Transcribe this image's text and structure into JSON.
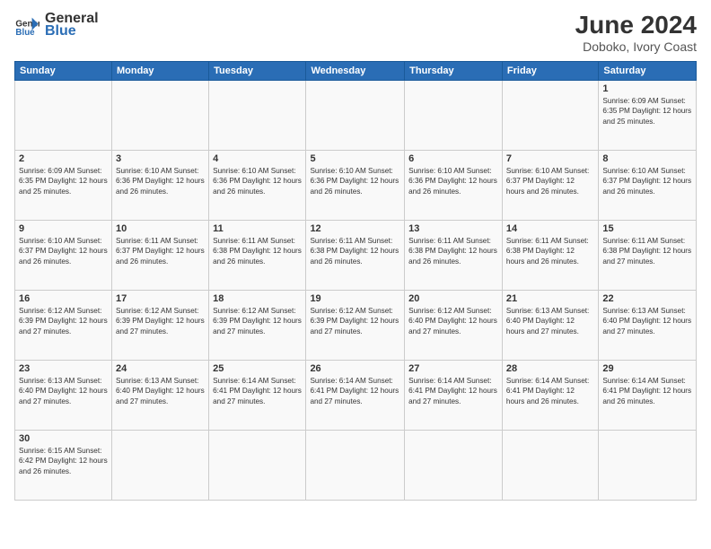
{
  "header": {
    "logo_general": "General",
    "logo_blue": "Blue",
    "month_title": "June 2024",
    "subtitle": "Doboko, Ivory Coast"
  },
  "days_of_week": [
    "Sunday",
    "Monday",
    "Tuesday",
    "Wednesday",
    "Thursday",
    "Friday",
    "Saturday"
  ],
  "weeks": [
    [
      {
        "day": "",
        "info": ""
      },
      {
        "day": "",
        "info": ""
      },
      {
        "day": "",
        "info": ""
      },
      {
        "day": "",
        "info": ""
      },
      {
        "day": "",
        "info": ""
      },
      {
        "day": "",
        "info": ""
      },
      {
        "day": "1",
        "info": "Sunrise: 6:09 AM\nSunset: 6:35 PM\nDaylight: 12 hours and 25 minutes."
      }
    ],
    [
      {
        "day": "2",
        "info": "Sunrise: 6:09 AM\nSunset: 6:35 PM\nDaylight: 12 hours and 25 minutes."
      },
      {
        "day": "3",
        "info": "Sunrise: 6:10 AM\nSunset: 6:36 PM\nDaylight: 12 hours and 26 minutes."
      },
      {
        "day": "4",
        "info": "Sunrise: 6:10 AM\nSunset: 6:36 PM\nDaylight: 12 hours and 26 minutes."
      },
      {
        "day": "5",
        "info": "Sunrise: 6:10 AM\nSunset: 6:36 PM\nDaylight: 12 hours and 26 minutes."
      },
      {
        "day": "6",
        "info": "Sunrise: 6:10 AM\nSunset: 6:36 PM\nDaylight: 12 hours and 26 minutes."
      },
      {
        "day": "7",
        "info": "Sunrise: 6:10 AM\nSunset: 6:37 PM\nDaylight: 12 hours and 26 minutes."
      },
      {
        "day": "8",
        "info": "Sunrise: 6:10 AM\nSunset: 6:37 PM\nDaylight: 12 hours and 26 minutes."
      }
    ],
    [
      {
        "day": "9",
        "info": "Sunrise: 6:10 AM\nSunset: 6:37 PM\nDaylight: 12 hours and 26 minutes."
      },
      {
        "day": "10",
        "info": "Sunrise: 6:11 AM\nSunset: 6:37 PM\nDaylight: 12 hours and 26 minutes."
      },
      {
        "day": "11",
        "info": "Sunrise: 6:11 AM\nSunset: 6:38 PM\nDaylight: 12 hours and 26 minutes."
      },
      {
        "day": "12",
        "info": "Sunrise: 6:11 AM\nSunset: 6:38 PM\nDaylight: 12 hours and 26 minutes."
      },
      {
        "day": "13",
        "info": "Sunrise: 6:11 AM\nSunset: 6:38 PM\nDaylight: 12 hours and 26 minutes."
      },
      {
        "day": "14",
        "info": "Sunrise: 6:11 AM\nSunset: 6:38 PM\nDaylight: 12 hours and 26 minutes."
      },
      {
        "day": "15",
        "info": "Sunrise: 6:11 AM\nSunset: 6:38 PM\nDaylight: 12 hours and 27 minutes."
      }
    ],
    [
      {
        "day": "16",
        "info": "Sunrise: 6:12 AM\nSunset: 6:39 PM\nDaylight: 12 hours and 27 minutes."
      },
      {
        "day": "17",
        "info": "Sunrise: 6:12 AM\nSunset: 6:39 PM\nDaylight: 12 hours and 27 minutes."
      },
      {
        "day": "18",
        "info": "Sunrise: 6:12 AM\nSunset: 6:39 PM\nDaylight: 12 hours and 27 minutes."
      },
      {
        "day": "19",
        "info": "Sunrise: 6:12 AM\nSunset: 6:39 PM\nDaylight: 12 hours and 27 minutes."
      },
      {
        "day": "20",
        "info": "Sunrise: 6:12 AM\nSunset: 6:40 PM\nDaylight: 12 hours and 27 minutes."
      },
      {
        "day": "21",
        "info": "Sunrise: 6:13 AM\nSunset: 6:40 PM\nDaylight: 12 hours and 27 minutes."
      },
      {
        "day": "22",
        "info": "Sunrise: 6:13 AM\nSunset: 6:40 PM\nDaylight: 12 hours and 27 minutes."
      }
    ],
    [
      {
        "day": "23",
        "info": "Sunrise: 6:13 AM\nSunset: 6:40 PM\nDaylight: 12 hours and 27 minutes."
      },
      {
        "day": "24",
        "info": "Sunrise: 6:13 AM\nSunset: 6:40 PM\nDaylight: 12 hours and 27 minutes."
      },
      {
        "day": "25",
        "info": "Sunrise: 6:14 AM\nSunset: 6:41 PM\nDaylight: 12 hours and 27 minutes."
      },
      {
        "day": "26",
        "info": "Sunrise: 6:14 AM\nSunset: 6:41 PM\nDaylight: 12 hours and 27 minutes."
      },
      {
        "day": "27",
        "info": "Sunrise: 6:14 AM\nSunset: 6:41 PM\nDaylight: 12 hours and 27 minutes."
      },
      {
        "day": "28",
        "info": "Sunrise: 6:14 AM\nSunset: 6:41 PM\nDaylight: 12 hours and 26 minutes."
      },
      {
        "day": "29",
        "info": "Sunrise: 6:14 AM\nSunset: 6:41 PM\nDaylight: 12 hours and 26 minutes."
      }
    ],
    [
      {
        "day": "30",
        "info": "Sunrise: 6:15 AM\nSunset: 6:42 PM\nDaylight: 12 hours and 26 minutes."
      },
      {
        "day": "",
        "info": ""
      },
      {
        "day": "",
        "info": ""
      },
      {
        "day": "",
        "info": ""
      },
      {
        "day": "",
        "info": ""
      },
      {
        "day": "",
        "info": ""
      },
      {
        "day": "",
        "info": ""
      }
    ]
  ]
}
